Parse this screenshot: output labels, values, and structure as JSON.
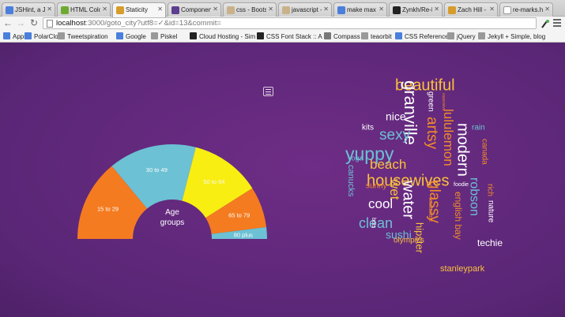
{
  "tabs": [
    {
      "label": "JSHint, a Java",
      "favicon": "#4a7fdc"
    },
    {
      "label": "HTML Color P",
      "favicon": "#6eaa2f"
    },
    {
      "label": "Staticity",
      "favicon": "#d69d2b",
      "active": true
    },
    {
      "label": "Components",
      "favicon": "#5c3e8f"
    },
    {
      "label": "css - Bootstr",
      "favicon": "#c9b28a"
    },
    {
      "label": "javascript - ",
      "favicon": "#c9b28a"
    },
    {
      "label": "make max wi",
      "favicon": "#4a7fdc"
    },
    {
      "label": "Zynkh/Re-M",
      "favicon": "#222222"
    },
    {
      "label": "Zach Hill - Ju",
      "favicon": "#d69d2b"
    },
    {
      "label": "re-marks.he",
      "favicon": "#ffffff"
    }
  ],
  "toolbar": {
    "back": "←",
    "forward": "→",
    "reload": "↻",
    "url_host": "localhost",
    "url_rest": ":3000/goto_city?utf8=✓&id=13&commit="
  },
  "bookmarks": [
    {
      "label": "Apps",
      "color": "#4a7fdc"
    },
    {
      "label": "PolarClock",
      "color": "#4a7fdc"
    },
    {
      "label": "Tweetspiration",
      "color": "#999999"
    },
    {
      "label": "Google",
      "color": "#4a7fdc"
    },
    {
      "label": "Piskel",
      "color": "#999999"
    },
    {
      "label": "Cloud Hosting - Sim",
      "color": "#222222"
    },
    {
      "label": "CSS Font Stack :: A c",
      "color": "#222222"
    },
    {
      "label": "Compass",
      "color": "#777777"
    },
    {
      "label": "teaorbit",
      "color": "#999999"
    },
    {
      "label": "CSS Reference",
      "color": "#4a7fdc"
    },
    {
      "label": "jQuery",
      "color": "#999999"
    },
    {
      "label": "Jekyll + Simple, blog",
      "color": "#999999"
    }
  ],
  "chart_data": {
    "type": "pie",
    "center_label_line1": "Age",
    "center_label_line2": "groups",
    "categories": [
      "15 to 29",
      "30 to 49",
      "50 to 64",
      "65 to 79",
      "80 plus"
    ],
    "values": [
      28,
      30,
      24,
      14,
      4
    ],
    "colors": [
      "#f47b20",
      "#6cc1d4",
      "#f8ee12",
      "#f47b20",
      "#6cc1d4"
    ],
    "label_colors": [
      "#ffffff",
      "#ffffff",
      "#f8f8f8",
      "#ffffff",
      "#ffffff"
    ]
  },
  "word_cloud": [
    {
      "text": "beautiful",
      "color": "#f9c13b"
    },
    {
      "text": "granville",
      "color": "#ffffff"
    },
    {
      "text": "lululemon",
      "color": "#f28b2a"
    },
    {
      "text": "green",
      "color": "#ffffff"
    },
    {
      "text": "nice",
      "color": "#ffffff"
    },
    {
      "text": "sexy",
      "color": "#6cc1d4"
    },
    {
      "text": "kits",
      "color": "#ffffff"
    },
    {
      "text": "artsy",
      "color": "#f28b2a"
    },
    {
      "text": "modern",
      "color": "#ffffff"
    },
    {
      "text": "rain",
      "color": "#6cc1d4"
    },
    {
      "text": "yuppy",
      "color": "#6cc1d4"
    },
    {
      "text": "canada",
      "color": "#f28b2a"
    },
    {
      "text": "beach",
      "color": "#f9c13b"
    },
    {
      "text": "yoga",
      "color": "#6cc1d4"
    },
    {
      "text": "housewives",
      "color": "#f9c13b"
    },
    {
      "text": "canucks",
      "color": "#6cc1d4"
    },
    {
      "text": "sunny",
      "color": "#f28b2a"
    },
    {
      "text": "water",
      "color": "#ffffff"
    },
    {
      "text": "foodie",
      "color": "#ffffff"
    },
    {
      "text": "robson",
      "color": "#6cc1d4"
    },
    {
      "text": "wet",
      "color": "#f9c13b"
    },
    {
      "text": "cool",
      "color": "#ffffff"
    },
    {
      "text": "glassy",
      "color": "#f28b2a"
    },
    {
      "text": "clean",
      "color": "#6cc1d4"
    },
    {
      "text": "english bay",
      "color": "#f28b2a"
    },
    {
      "text": "rich",
      "color": "#f28b2a"
    },
    {
      "text": "nature",
      "color": "#ffffff"
    },
    {
      "text": "sushi",
      "color": "#6cc1d4"
    },
    {
      "text": "westcoast",
      "color": "#f28b2a"
    },
    {
      "text": "olympics",
      "color": "#f9c13b"
    },
    {
      "text": "bots",
      "color": "#ffffff"
    },
    {
      "text": "hipster",
      "color": "#f9c13b"
    },
    {
      "text": "techie",
      "color": "#ffffff"
    },
    {
      "text": "stanleypark",
      "color": "#f9c13b"
    },
    {
      "text": "expensive",
      "color": "#f28b2a"
    }
  ]
}
